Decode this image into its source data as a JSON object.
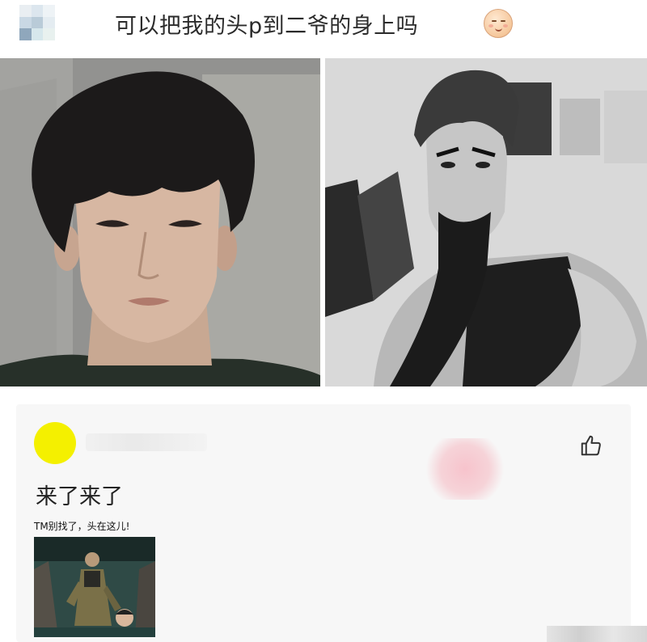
{
  "post": {
    "text": "可以把我的头p到二爷的身上吗",
    "emoji": "smirk-emoji"
  },
  "photos": {
    "left": "portrait-photo",
    "right": "figure-photo"
  },
  "comment": {
    "text": "来了来了",
    "like_icon": "thumbs-up-icon",
    "meme_caption": "TM别找了，头在这儿!"
  },
  "colors": {
    "avatar": "#f4f000",
    "card_bg": "#f7f7f7",
    "text": "#2b2b2b"
  }
}
